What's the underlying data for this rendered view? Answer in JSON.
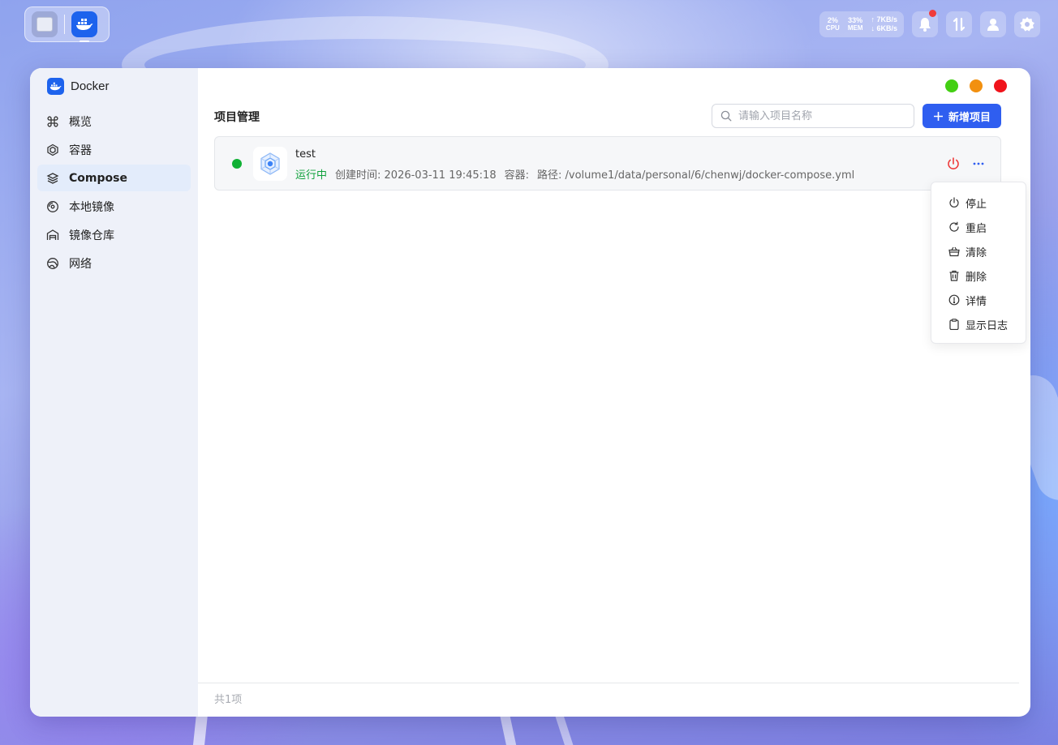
{
  "taskbar": {
    "apps": [
      {
        "name": "files-app-icon"
      },
      {
        "name": "docker-app-icon"
      }
    ]
  },
  "system": {
    "cpu_value": "2%",
    "cpu_label": "CPU",
    "mem_value": "33%",
    "mem_label": "MEM",
    "net_up": "↑ 7KB/s",
    "net_down": "↓ 6KB/s"
  },
  "window": {
    "app_name": "Docker",
    "controls": {
      "minimize_color": "#43cf13",
      "maximize_color": "#f2900f",
      "close_color": "#f0131b"
    }
  },
  "sidebar": {
    "items": [
      {
        "label": "概览",
        "icon": "command-icon",
        "active": false
      },
      {
        "label": "容器",
        "icon": "container-icon",
        "active": false
      },
      {
        "label": "Compose",
        "icon": "layers-icon",
        "active": true
      },
      {
        "label": "本地镜像",
        "icon": "disc-icon",
        "active": false
      },
      {
        "label": "镜像仓库",
        "icon": "warehouse-icon",
        "active": false
      },
      {
        "label": "网络",
        "icon": "network-icon",
        "active": false
      }
    ]
  },
  "main": {
    "title": "项目管理",
    "search_placeholder": "请输入项目名称",
    "add_button": "新增项目",
    "accent_color": "#2f5ef0"
  },
  "projects": [
    {
      "name": "test",
      "status": "运行中",
      "status_color": "#10a13c",
      "created": "创建时间: 2026-03-11 19:45:18",
      "containers": "容器:",
      "path": "路径: /volume1/data/personal/6/chenwj/docker-compose.yml"
    }
  ],
  "dropdown": {
    "items": [
      {
        "label": "停止",
        "icon": "power-icon"
      },
      {
        "label": "重启",
        "icon": "restart-icon"
      },
      {
        "label": "清除",
        "icon": "basket-icon"
      },
      {
        "label": "删除",
        "icon": "trash-icon"
      },
      {
        "label": "详情",
        "icon": "info-icon"
      },
      {
        "label": "显示日志",
        "icon": "clipboard-icon"
      }
    ]
  },
  "footer": {
    "count": "共1项"
  }
}
